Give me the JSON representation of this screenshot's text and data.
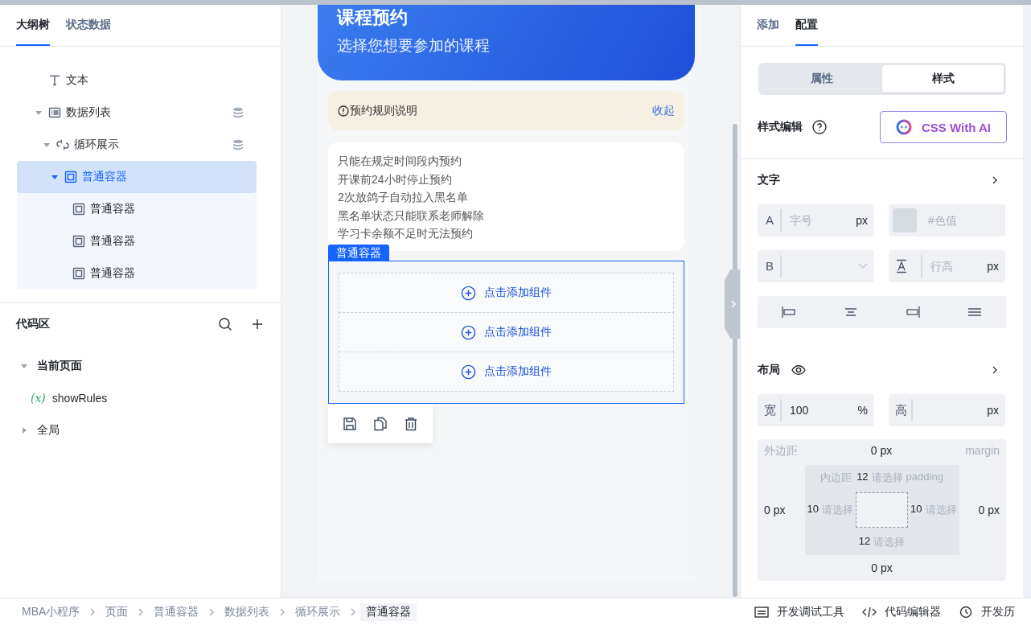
{
  "left_panel": {
    "tabs": [
      {
        "label": "大纲树",
        "selected": true
      },
      {
        "label": "状态数据",
        "selected": false
      }
    ],
    "outline": [
      {
        "label": "文本",
        "kind": "text",
        "selected": false,
        "data_bound": false
      },
      {
        "label": "数据列表",
        "kind": "list",
        "expanded": true,
        "selected": false,
        "data_bound": true,
        "children": [
          {
            "label": "循环展示",
            "kind": "loop",
            "expanded": true,
            "selected": false,
            "data_bound": true,
            "children": [
              {
                "label": "普通容器",
                "kind": "container",
                "expanded": true,
                "selected": true,
                "data_bound": false,
                "children": [
                  {
                    "label": "普通容器",
                    "kind": "container",
                    "selected": false,
                    "data_bound": false
                  },
                  {
                    "label": "普通容器",
                    "kind": "container",
                    "selected": false,
                    "data_bound": false
                  },
                  {
                    "label": "普通容器",
                    "kind": "container",
                    "selected": false,
                    "data_bound": false
                  }
                ]
              }
            ]
          }
        ]
      }
    ],
    "code_area": {
      "title": "代码区",
      "tree": [
        {
          "label": "当前页面",
          "expanded": true,
          "children": [
            {
              "label": "showRules",
              "kind": "variable",
              "symbol": "(x)"
            }
          ]
        },
        {
          "label": "全局",
          "expanded": false
        }
      ]
    }
  },
  "canvas": {
    "header": {
      "title": "课程预约",
      "subtitle": "选择您想要参加的课程"
    },
    "notice": {
      "label": "预约规则说明",
      "action": "收起"
    },
    "rules": [
      "只能在规定时间段内预约",
      "开课前24小时停止预约",
      "2次放鸽子自动拉入黑名单",
      "黑名单状态只能联系老师解除",
      "学习卡余额不足时无法预约"
    ],
    "container": {
      "tag": "普通容器",
      "selected": true,
      "slots": [
        "点击添加组件",
        "点击添加组件",
        "点击添加组件"
      ]
    }
  },
  "right_panel": {
    "tabs": [
      {
        "label": "添加",
        "selected": false
      },
      {
        "label": "配置",
        "selected": true
      }
    ],
    "segments": [
      {
        "label": "属性",
        "selected": false
      },
      {
        "label": "样式",
        "selected": true
      }
    ],
    "style_editor": {
      "label": "样式编辑",
      "ai_button": "CSS With AI"
    },
    "text_section": {
      "title": "文字",
      "font_size": {
        "prefix": "A",
        "placeholder": "字号",
        "unit": "px"
      },
      "color": {
        "placeholder": "#色值"
      },
      "font_weight": {
        "prefix": "B"
      },
      "line_height": {
        "placeholder": "行高",
        "unit": "px"
      }
    },
    "layout_section": {
      "title": "布局",
      "width": {
        "prefix": "宽",
        "value": "100",
        "unit": "%"
      },
      "height": {
        "prefix": "高",
        "unit": "px"
      },
      "margin": {
        "label": "外边距",
        "tag": "margin",
        "top": {
          "value": "0",
          "unit": "px"
        },
        "left": {
          "value": "0",
          "unit": "px"
        },
        "right": {
          "value": "0",
          "unit": "px"
        },
        "bottom": {
          "value": "0",
          "unit": "px"
        }
      },
      "padding": {
        "label": "内边距",
        "tag": "padding",
        "top": {
          "value": "12",
          "placeholder": "请选择"
        },
        "left": {
          "value": "10",
          "placeholder": "请选择"
        },
        "right": {
          "value": "10",
          "placeholder": "请选择"
        },
        "bottom": {
          "value": "12",
          "placeholder": "请选择"
        }
      }
    }
  },
  "status_bar": {
    "breadcrumb": [
      {
        "label": "MBA小程序",
        "selected": false
      },
      {
        "label": "页面",
        "selected": false
      },
      {
        "label": "普通容器",
        "selected": false
      },
      {
        "label": "数据列表",
        "selected": false
      },
      {
        "label": "循环展示",
        "selected": false
      },
      {
        "label": "普通容器",
        "selected": true
      }
    ],
    "tools": [
      {
        "label": "开发调试工具",
        "kind": "panel"
      },
      {
        "label": "代码编辑器",
        "kind": "code"
      },
      {
        "label": "开发历",
        "kind": "history"
      }
    ]
  }
}
